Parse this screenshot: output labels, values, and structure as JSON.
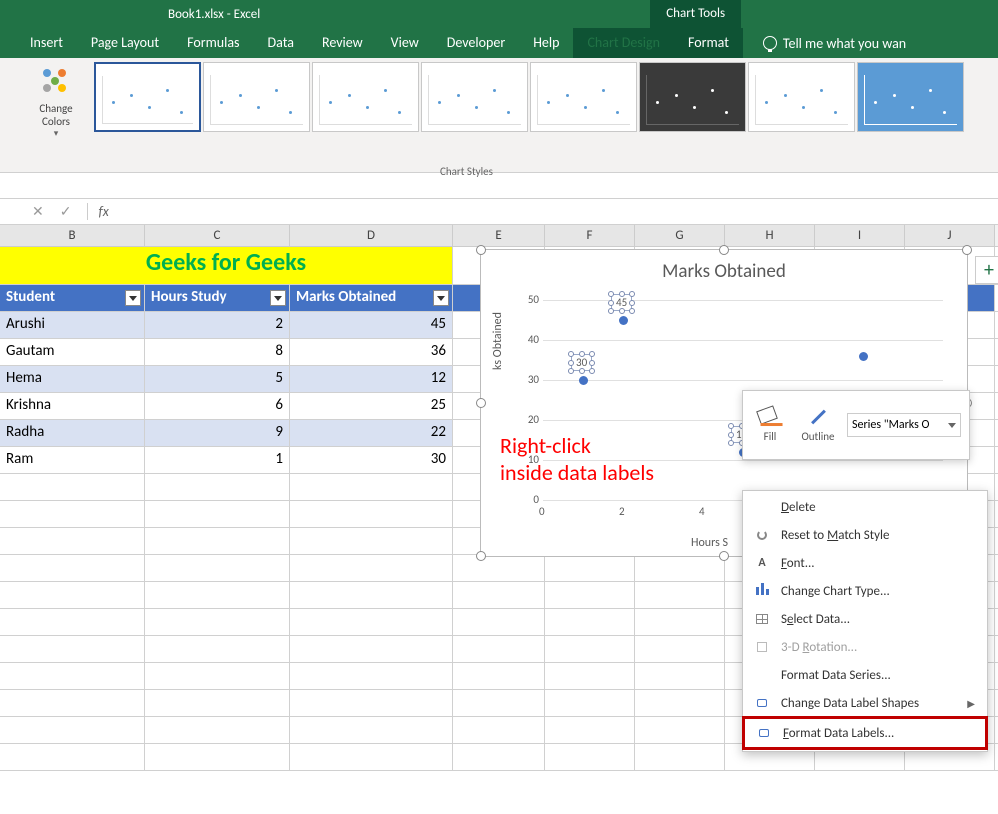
{
  "title": "Book1.xlsx - Excel",
  "chart_tools_label": "Chart Tools",
  "tabs": [
    "Insert",
    "Page Layout",
    "Formulas",
    "Data",
    "Review",
    "View",
    "Developer",
    "Help",
    "Chart Design",
    "Format"
  ],
  "tell_me": "Tell me what you wan",
  "change_colors": "Change Colors",
  "chart_styles_label": "Chart Styles",
  "col_letters": [
    "B",
    "C",
    "D",
    "E",
    "F",
    "G",
    "H",
    "I",
    "J"
  ],
  "sheet_title": "Geeks for Geeks",
  "table": {
    "headers": [
      "Student",
      "Hours Study",
      "Marks Obtained"
    ],
    "rows": [
      {
        "student": "Arushi",
        "hours": 2,
        "marks": 45
      },
      {
        "student": "Gautam",
        "hours": 8,
        "marks": 36
      },
      {
        "student": "Hema",
        "hours": 5,
        "marks": 12
      },
      {
        "student": "Krishna",
        "hours": 6,
        "marks": 25
      },
      {
        "student": "Radha",
        "hours": 9,
        "marks": 22
      },
      {
        "student": "Ram",
        "hours": 1,
        "marks": 30
      }
    ]
  },
  "chart_data": {
    "type": "scatter",
    "title": "Marks Obtained",
    "xlabel": "Hours S",
    "ylabel_fragment": "ks Obtained",
    "xlim": [
      0,
      10
    ],
    "ylim": [
      0,
      50
    ],
    "x_ticks": [
      0,
      2,
      4
    ],
    "y_ticks": [
      0,
      10,
      20,
      30,
      40,
      50
    ],
    "series": [
      {
        "name": "Marks Obtained",
        "x": [
          2,
          8,
          5,
          6,
          9,
          1
        ],
        "y": [
          45,
          36,
          12,
          25,
          22,
          30
        ]
      }
    ],
    "visible_data_labels": [
      {
        "x": 2,
        "y": 45,
        "text": "45"
      },
      {
        "x": 1,
        "y": 30,
        "text": "30"
      },
      {
        "x": 5,
        "y": 12,
        "text": "12"
      }
    ]
  },
  "mini_toolbar": {
    "fill": "Fill",
    "outline": "Outline",
    "series": "Series \"Marks O"
  },
  "ctx_menu": [
    {
      "icon": "",
      "label": "Delete",
      "u": 0
    },
    {
      "icon": "reset",
      "label": "Reset to Match Style",
      "u": 9
    },
    {
      "icon": "A",
      "label": "Font...",
      "u": 0
    },
    {
      "icon": "bars",
      "label": "Change Chart Type...",
      "u": -1
    },
    {
      "icon": "grid",
      "label": "Select Data...",
      "u": 1
    },
    {
      "icon": "cube",
      "label": "3-D Rotation...",
      "u": 4,
      "disabled": true
    },
    {
      "icon": "",
      "label": "Format Data Series...",
      "u": -1
    },
    {
      "icon": "shape",
      "label": "Change Data Label Shapes",
      "u": -1,
      "arrow": true
    },
    {
      "icon": "shape",
      "label": "Format Data Labels...",
      "u": 0,
      "highlighted": true
    }
  ],
  "annotation": {
    "line1": "Right-click",
    "line2": "inside data labels"
  }
}
